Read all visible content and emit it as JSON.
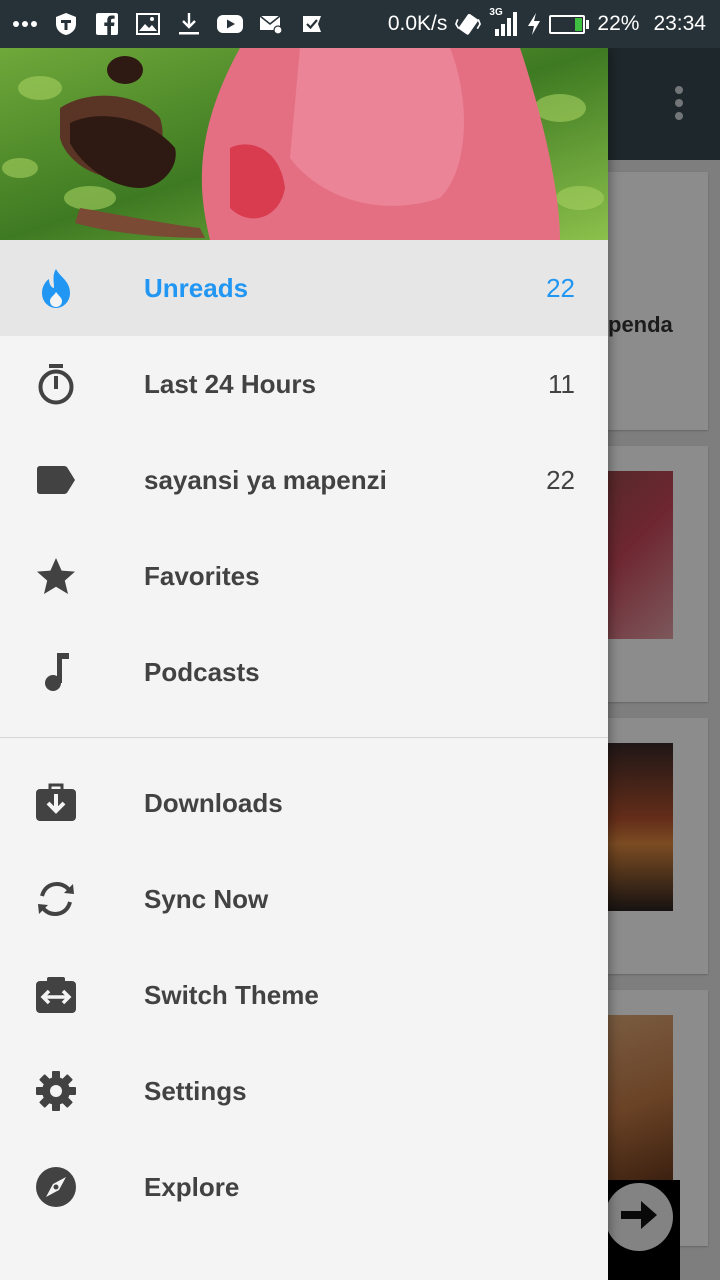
{
  "status_bar": {
    "net_speed": "0.0K/s",
    "network_type": "3G",
    "battery_percent": "22%",
    "battery_level": 0.22,
    "time": "23:34",
    "icons": [
      "more-dots-icon",
      "shield-app-icon",
      "facebook-icon",
      "gallery-icon",
      "download-icon",
      "youtube-icon",
      "mail-settings-icon",
      "checkmark-app-icon",
      "vibrate-icon",
      "signal-icon",
      "charging-icon",
      "battery-icon"
    ]
  },
  "background_app": {
    "card_text_fragment": "penda",
    "overflow_icon": "overflow-menu-icon",
    "fab_icon": "arrow-right-icon"
  },
  "drawer": {
    "active_color": "#2196f3",
    "primary_items": [
      {
        "label": "Unreads",
        "count": "22",
        "icon": "flame-icon",
        "active": true
      },
      {
        "label": "Last 24 Hours",
        "count": "11",
        "icon": "timer-icon",
        "active": false
      },
      {
        "label": "sayansi ya mapenzi",
        "count": "22",
        "icon": "label-tag-icon",
        "active": false
      },
      {
        "label": "Favorites",
        "count": "",
        "icon": "star-icon",
        "active": false
      },
      {
        "label": "Podcasts",
        "count": "",
        "icon": "music-note-icon",
        "active": false
      }
    ],
    "secondary_items": [
      {
        "label": "Downloads",
        "icon": "download-briefcase-icon"
      },
      {
        "label": "Sync Now",
        "icon": "sync-icon"
      },
      {
        "label": "Switch Theme",
        "icon": "switch-theme-icon"
      },
      {
        "label": "Settings",
        "icon": "gear-icon"
      },
      {
        "label": "Explore",
        "icon": "compass-icon"
      }
    ]
  }
}
